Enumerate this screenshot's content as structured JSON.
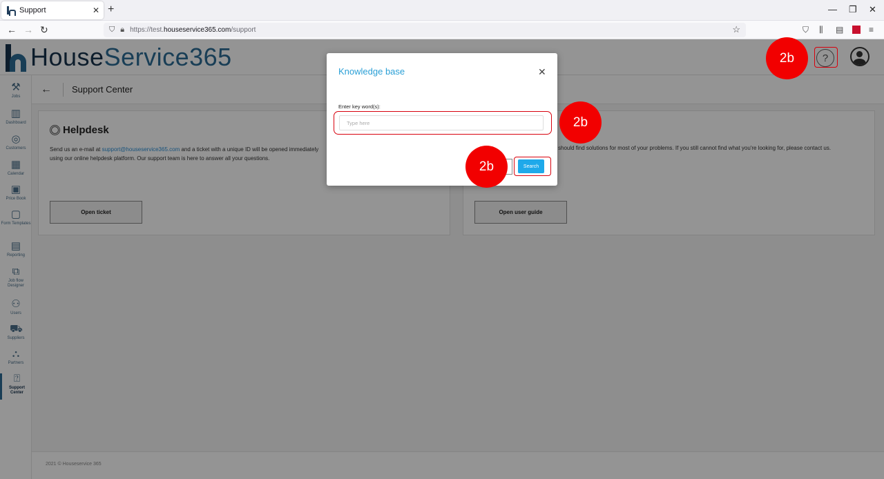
{
  "browser": {
    "tab_title": "Support",
    "url_prefix": "https://test.",
    "url_host": "houseservice365.com",
    "url_path": "/support"
  },
  "app": {
    "logo_part1": "House",
    "logo_part2": "Service365",
    "page_title": "Support Center",
    "sidebar": [
      {
        "label": "Jobs",
        "icon": "tools-icon"
      },
      {
        "label": "Dashboard",
        "icon": "chart-icon"
      },
      {
        "label": "Customers",
        "icon": "customers-icon"
      },
      {
        "label": "Calendar",
        "icon": "calendar-icon"
      },
      {
        "label": "Price Book",
        "icon": "price-icon"
      },
      {
        "label": "Form Templates",
        "icon": "form-icon"
      },
      {
        "label": "Reporting",
        "icon": "report-icon"
      },
      {
        "label": "Job flow Designer",
        "icon": "flow-icon"
      },
      {
        "label": "Users",
        "icon": "users-icon"
      },
      {
        "label": "Suppliers",
        "icon": "truck-icon"
      },
      {
        "label": "Partners",
        "icon": "partners-icon"
      },
      {
        "label": "Support Center",
        "icon": "support-icon"
      }
    ],
    "helpdesk": {
      "title": "Helpdesk",
      "text_before": "Send us an e-mail at ",
      "email": "support@houseservice365.com",
      "text_after": " and a ticket with a unique ID will be opened immediately",
      "text_line2": "using our online helpdesk platform. Our support team is here to answer all your questions.",
      "button": "Open ticket"
    },
    "userguide": {
      "text": "should find solutions for most of your problems. If you still cannot find what you're looking for, please contact us.",
      "button": "Open user guide"
    },
    "footer": "2021 © Houseservice 365"
  },
  "modal": {
    "title": "Knowledge base",
    "label": "Enter key word(s):",
    "placeholder": "Type here",
    "value": "",
    "search_button": "Search"
  },
  "annotations": {
    "badge_label": "2b",
    "color": "#f20000"
  }
}
